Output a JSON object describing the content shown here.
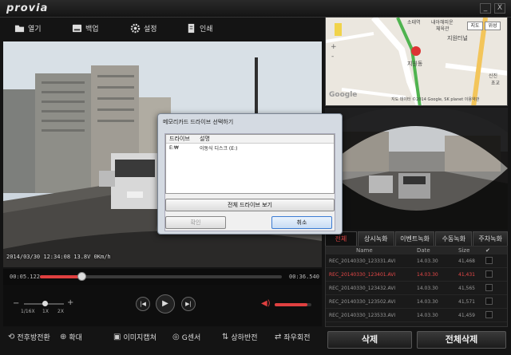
{
  "app": {
    "logo": "provia"
  },
  "window": {
    "minimize": "_",
    "close": "X"
  },
  "toolbar": {
    "open": "열기",
    "backup": "백업",
    "settings": "설정",
    "print": "인쇄"
  },
  "video": {
    "timestamp": "2014/03/30 12:34:08 13.8V 0Km/h",
    "time_current": "00:05.122",
    "time_total": "00:36.540",
    "progress": 0.17,
    "volume": 0.9
  },
  "speed": {
    "s1": "1/16X",
    "s2": "1X",
    "s3": "2X"
  },
  "controls": {
    "prev": "|◀",
    "play": "▶",
    "next": "▶|"
  },
  "bottom": {
    "rear_front": "전후방전환",
    "zoom": "확대",
    "capture": "이미지캡쳐",
    "gsensor": "G센서",
    "flip": "상하반전",
    "rotate": "좌우회전"
  },
  "map": {
    "view_btn": "지도",
    "sat_btn": "위성",
    "place1": "소태역",
    "place2": "내아해피운",
    "place3": "체육관",
    "place4": "지원터널",
    "place5": "지원동",
    "place6": "신진",
    "place7": "초교",
    "copyright": "지도 데이터 ©2014 Google, SK planet 이용약관",
    "google": "Google",
    "zoom_in": "+",
    "zoom_out": "-"
  },
  "tabs": [
    "전체",
    "상시녹화",
    "이벤트녹화",
    "수동녹화",
    "주차녹화"
  ],
  "list": {
    "headers": {
      "name": "Name",
      "date": "Date",
      "size": "Size"
    },
    "rows": [
      {
        "name": "REC_20140330_123331.AVI",
        "date": "14.03.30",
        "size": "41,468",
        "selected": false
      },
      {
        "name": "REC_20140330_123401.AVI",
        "date": "14.03.30",
        "size": "41,431",
        "selected": true
      },
      {
        "name": "REC_20140330_123432.AVI",
        "date": "14.03.30",
        "size": "41,565",
        "selected": false
      },
      {
        "name": "REC_20140330_123502.AVI",
        "date": "14.03.30",
        "size": "41,571",
        "selected": false
      },
      {
        "name": "REC_20140330_123533.AVI",
        "date": "14.03.30",
        "size": "41,459",
        "selected": false
      }
    ]
  },
  "actions": {
    "delete": "삭제",
    "delete_all": "전체삭제"
  },
  "dialog": {
    "title": "메모리카드 드라이브 선택하기",
    "col_drive": "드라이브",
    "col_desc": "설명",
    "drive": "E:₩",
    "desc": "이동식 디스크 (E:)",
    "show_all": "전체 드라이브 보기",
    "ok": "확인",
    "cancel": "취소"
  },
  "colors": {
    "accent": "#e04040",
    "bg": "#141414"
  }
}
